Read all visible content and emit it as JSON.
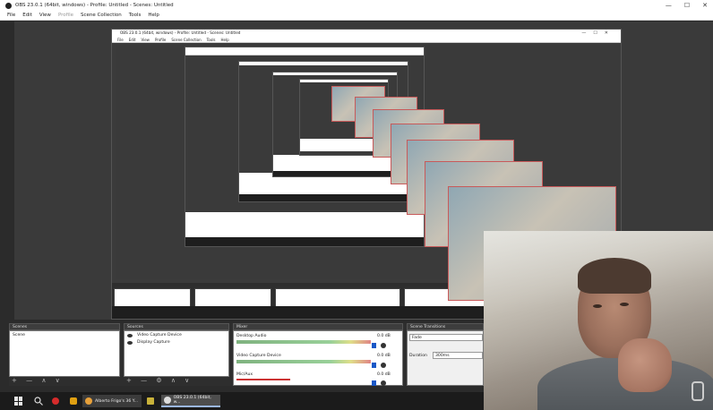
{
  "window": {
    "title": "OBS 23.0.1 (64bit, windows) - Profile: Untitled - Scenes: Untitled",
    "controls": [
      "—",
      "☐",
      "✕"
    ]
  },
  "menu": {
    "items": [
      "File",
      "Edit",
      "View",
      "Profile",
      "Scene Collection",
      "Tools",
      "Help"
    ]
  },
  "docks": {
    "scenes": {
      "header": "Scenes",
      "items": [
        "Scene"
      ],
      "footer": "+ — ∧ ∨"
    },
    "sources": {
      "header": "Sources",
      "items": [
        "Video Capture Device",
        "Display Capture"
      ],
      "footer": "+ — ⚙ ∧ ∨"
    },
    "mixer": {
      "header": "Mixer",
      "channels": [
        {
          "name": "Desktop Audio",
          "db": "0.0 dB"
        },
        {
          "name": "Video Capture Device",
          "db": "0.0 dB"
        },
        {
          "name": "Mic/Aux",
          "db": "0.0 dB"
        }
      ]
    },
    "transitions": {
      "header": "Scene Transitions",
      "type": "Fade",
      "duration_label": "Duration",
      "duration_value": "300ms"
    }
  },
  "taskbar": {
    "tasks": [
      {
        "label": "Alberto Frigo's 36 Y..."
      },
      {
        "label": "OBS 23.0.1 (64bit, w..."
      }
    ]
  },
  "colors": {
    "selection_border": "#c85a5a",
    "volume_blue": "#1b58c7",
    "taskbar_bg": "#1b1b1b"
  }
}
